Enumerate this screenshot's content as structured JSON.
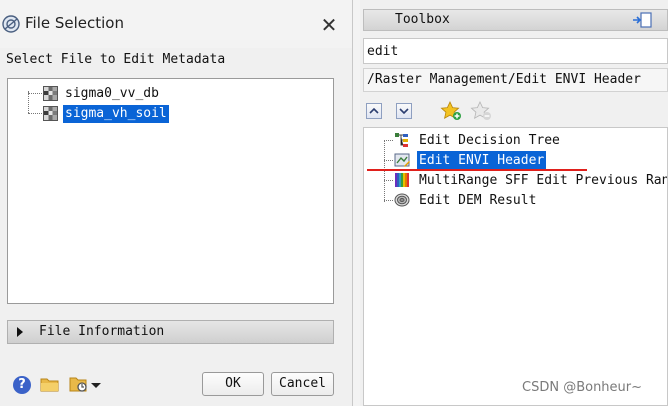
{
  "dialog": {
    "title": "File Selection",
    "close_glyph": "✕",
    "select_label": "Select File to Edit Metadata",
    "files": [
      {
        "name": "sigma0_vv_db",
        "selected": false,
        "icon": "raster-icon"
      },
      {
        "name": "sigma_vh_soil",
        "selected": true,
        "icon": "raster-icon"
      }
    ],
    "file_info_label": "File Information",
    "ok_label": "OK",
    "cancel_label": "Cancel",
    "help_glyph": "?"
  },
  "toolbox": {
    "title": "Toolbox",
    "search_value": "edit",
    "path": "/Raster Management/Edit ENVI Header",
    "tools": [
      {
        "label": "Edit Decision Tree",
        "icon": "decision-tree-icon",
        "selected": false
      },
      {
        "label": "Edit ENVI Header",
        "icon": "envi-header-icon",
        "selected": true
      },
      {
        "label": "MultiRange SFF Edit Previous Ran",
        "icon": "multirange-sff-icon",
        "selected": false
      },
      {
        "label": "Edit DEM Result",
        "icon": "dem-result-icon",
        "selected": false
      }
    ]
  },
  "watermark": "CSDN @Bonheur~",
  "colors": {
    "selection": "#0a64d6",
    "annotation_underline": "#e0201c"
  }
}
